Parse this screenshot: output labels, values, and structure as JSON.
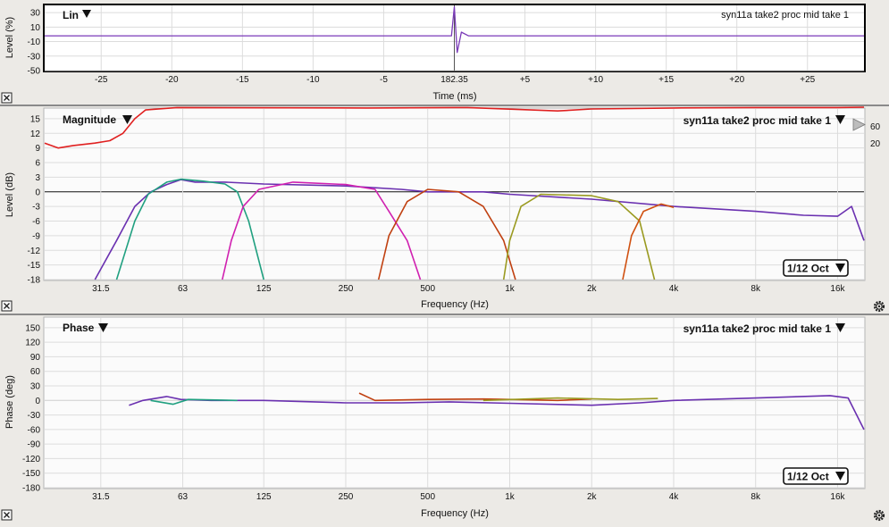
{
  "panels": {
    "impulse": {
      "title": "Lin",
      "trace_label": "syn11a take2 proc mid take 1",
      "y_label": "Level (%)",
      "y_ticks": [
        "30",
        "10",
        "-10",
        "-30",
        "-50"
      ],
      "x_label": "Time (ms)",
      "x_ticks": [
        "-25",
        "-20",
        "-15",
        "-10",
        "-5",
        "182.35",
        "+5",
        "+10",
        "+15",
        "+20",
        "+25"
      ]
    },
    "magnitude": {
      "title": "Magnitude",
      "trace_label": "syn11a take2 proc mid take 1",
      "y_label": "Level (dB)",
      "y_ticks": [
        "15",
        "12",
        "9",
        "6",
        "3",
        "0",
        "-3",
        "-6",
        "-9",
        "-12",
        "-15",
        "-18"
      ],
      "right_ticks": [
        "60",
        "20"
      ],
      "x_label": "Frequency (Hz)",
      "x_ticks": [
        "31.5",
        "63",
        "125",
        "250",
        "500",
        "1k",
        "2k",
        "4k",
        "8k",
        "16k"
      ],
      "smoothing": "1/12 Oct"
    },
    "phase": {
      "title": "Phase",
      "trace_label": "syn11a take2 proc mid take 1",
      "y_label": "Phase (deg)",
      "y_ticks": [
        "150",
        "120",
        "90",
        "60",
        "30",
        "0",
        "-30",
        "-60",
        "-90",
        "-120",
        "-150",
        "-180"
      ],
      "x_label": "Frequency (Hz)",
      "x_ticks": [
        "31.5",
        "63",
        "125",
        "250",
        "500",
        "1k",
        "2k",
        "4k",
        "8k",
        "16k"
      ],
      "smoothing": "1/12 Oct"
    }
  },
  "chart_data": [
    {
      "type": "line",
      "title": "Lin",
      "xlabel": "Time (ms)",
      "ylabel": "Level (%)",
      "ylim": [
        -50,
        40
      ],
      "xlim": [
        -29,
        29
      ],
      "x_offset_label": "182.35",
      "series": [
        {
          "name": "syn11a take2 proc mid take 1",
          "color": "#7a3ab8",
          "points": [
            [
              -29,
              -2
            ],
            [
              -0.2,
              -2
            ],
            [
              0,
              38
            ],
            [
              0.2,
              -25
            ],
            [
              0.5,
              3
            ],
            [
              1,
              -2
            ],
            [
              29,
              -2
            ]
          ]
        }
      ]
    },
    {
      "type": "line",
      "title": "Magnitude",
      "xlabel": "Frequency (Hz)",
      "ylabel": "Level (dB)",
      "ylim": [
        -18,
        17
      ],
      "xscale": "log",
      "xlim": [
        19.6,
        20000
      ],
      "series": [
        {
          "color": "#e02020",
          "points": [
            [
              19.6,
              10
            ],
            [
              22,
              9
            ],
            [
              25,
              9.5
            ],
            [
              30,
              10
            ],
            [
              34,
              10.5
            ],
            [
              38,
              12
            ],
            [
              42,
              15
            ],
            [
              46,
              16.8
            ],
            [
              60,
              17.3
            ],
            [
              300,
              17.2
            ],
            [
              700,
              17.3
            ],
            [
              1200,
              16.8
            ],
            [
              1500,
              16.6
            ],
            [
              2000,
              17
            ],
            [
              4000,
              17.2
            ],
            [
              8000,
              17.3
            ],
            [
              16000,
              17.3
            ],
            [
              20000,
              17.5
            ]
          ]
        },
        {
          "color": "#6a30b0",
          "points": [
            [
              30,
              -18
            ],
            [
              36,
              -10
            ],
            [
              42,
              -3
            ],
            [
              48,
              0
            ],
            [
              55,
              1.5
            ],
            [
              62,
              2.5
            ],
            [
              70,
              2
            ],
            [
              90,
              2
            ],
            [
              125,
              1.6
            ],
            [
              250,
              1.2
            ],
            [
              400,
              0.5
            ],
            [
              500,
              0
            ],
            [
              800,
              0
            ],
            [
              1000,
              -0.5
            ],
            [
              2000,
              -1.5
            ],
            [
              4000,
              -3
            ],
            [
              8000,
              -4
            ],
            [
              12000,
              -4.8
            ],
            [
              16000,
              -5
            ],
            [
              18000,
              -3
            ],
            [
              20000,
              -10
            ]
          ]
        },
        {
          "color": "#20a080",
          "points": [
            [
              36,
              -18
            ],
            [
              42,
              -6
            ],
            [
              47,
              -0.5
            ],
            [
              55,
              2
            ],
            [
              62,
              2.6
            ],
            [
              75,
              2.2
            ],
            [
              90,
              1.6
            ],
            [
              100,
              0
            ],
            [
              110,
              -6
            ],
            [
              125,
              -18
            ]
          ]
        },
        {
          "color": "#d020b0",
          "points": [
            [
              88,
              -18
            ],
            [
              95,
              -10
            ],
            [
              105,
              -3
            ],
            [
              120,
              0.5
            ],
            [
              160,
              2
            ],
            [
              250,
              1.5
            ],
            [
              320,
              0.5
            ],
            [
              360,
              -4
            ],
            [
              420,
              -10
            ],
            [
              470,
              -18
            ]
          ]
        },
        {
          "color": "#c04010",
          "points": [
            [
              330,
              -18
            ],
            [
              360,
              -9
            ],
            [
              420,
              -2
            ],
            [
              500,
              0.5
            ],
            [
              650,
              0
            ],
            [
              800,
              -3
            ],
            [
              950,
              -10
            ],
            [
              1050,
              -18
            ]
          ]
        },
        {
          "color": "#9a9a20",
          "points": [
            [
              950,
              -18
            ],
            [
              1000,
              -10
            ],
            [
              1100,
              -3
            ],
            [
              1300,
              -0.5
            ],
            [
              2000,
              -0.8
            ],
            [
              2500,
              -2
            ],
            [
              3000,
              -6
            ],
            [
              3400,
              -18
            ]
          ]
        },
        {
          "color": "#d05010",
          "points": [
            [
              2600,
              -18
            ],
            [
              2800,
              -9
            ],
            [
              3100,
              -4
            ],
            [
              3600,
              -2.5
            ],
            [
              4000,
              -3.2
            ]
          ]
        }
      ]
    },
    {
      "type": "line",
      "title": "Phase",
      "xlabel": "Frequency (Hz)",
      "ylabel": "Phase (deg)",
      "ylim": [
        -180,
        170
      ],
      "xscale": "log",
      "xlim": [
        19.6,
        20000
      ],
      "series": [
        {
          "color": "#6a30b0",
          "points": [
            [
              40,
              -10
            ],
            [
              45,
              0
            ],
            [
              55,
              8
            ],
            [
              62,
              2
            ],
            [
              80,
              0
            ],
            [
              125,
              0
            ],
            [
              250,
              -5
            ],
            [
              400,
              -5
            ],
            [
              600,
              -3
            ],
            [
              1000,
              -6
            ],
            [
              2000,
              -10
            ],
            [
              3000,
              -5
            ],
            [
              4000,
              0
            ],
            [
              8000,
              5
            ],
            [
              15000,
              10
            ],
            [
              17500,
              5
            ],
            [
              20000,
              -60
            ]
          ]
        },
        {
          "color": "#20a080",
          "points": [
            [
              48,
              0
            ],
            [
              58,
              -8
            ],
            [
              66,
              2
            ],
            [
              100,
              0
            ]
          ]
        },
        {
          "color": "#c04010",
          "points": [
            [
              280,
              15
            ],
            [
              320,
              0
            ],
            [
              500,
              2
            ],
            [
              800,
              3
            ],
            [
              1000,
              2
            ],
            [
              1500,
              0
            ],
            [
              2000,
              3
            ]
          ]
        },
        {
          "color": "#9a9a20",
          "points": [
            [
              800,
              0
            ],
            [
              1500,
              5
            ],
            [
              2500,
              2
            ],
            [
              3500,
              4
            ]
          ]
        }
      ]
    }
  ]
}
